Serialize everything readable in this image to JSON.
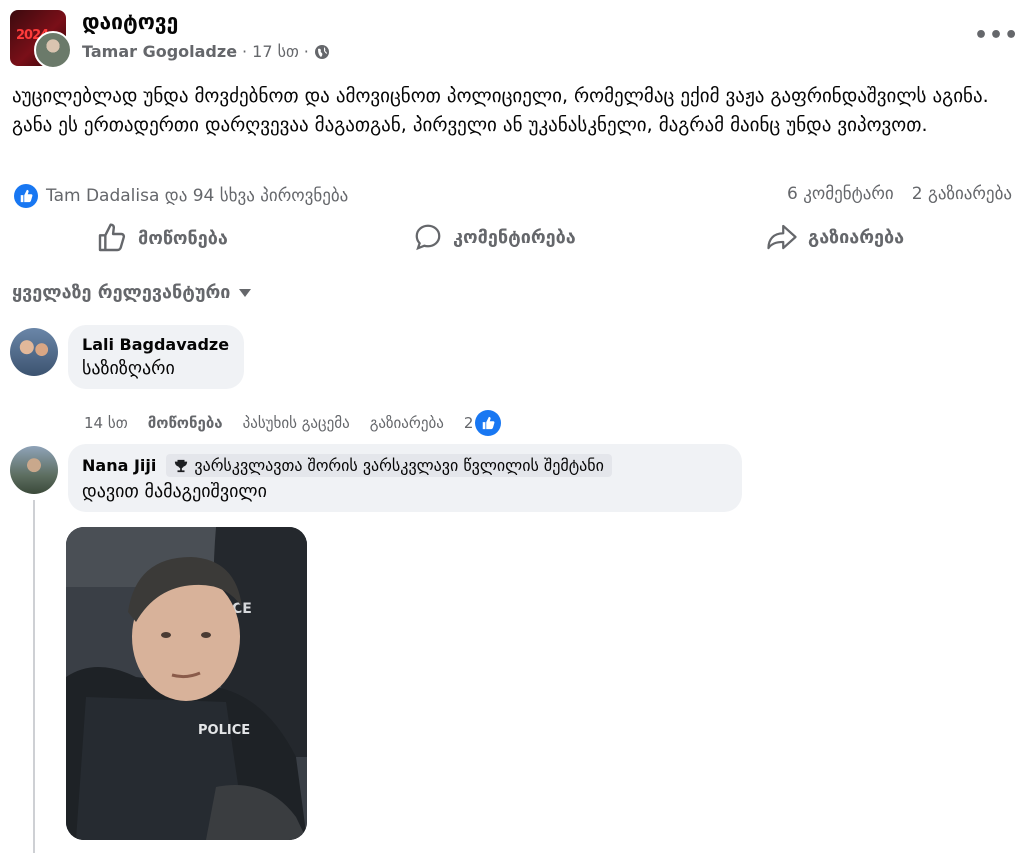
{
  "post": {
    "group_name": "დაიტოვე",
    "author": "Tamar Gogoladze",
    "time": "17 სთ",
    "dot": "·",
    "privacy_icon": "globe-icon",
    "more_label": "•••",
    "text": "აუცილებლად უნდა მოვძებნოთ და ამოვიცნოთ პოლიციელი, რომელმაც ექიმ ვაჟა გაფრინდაშვილს აგინა. განა ეს ერთადერთი დარღვევაა მაგათგან, პირველი ან უკანასკნელი, მაგრამ მაინც უნდა ვიპოვოთ.",
    "reactions_text": "Tam Dadalisa და 94 სხვა პიროვნება",
    "comments_count": "6 კომენტარი",
    "shares_count": "2 გაზიარება"
  },
  "actions": {
    "like": "მოწონება",
    "comment": "კომენტირება",
    "share": "გაზიარება"
  },
  "sort_label": "ყველაზე რელევანტური",
  "comments": [
    {
      "author": "Lali Bagdavadze",
      "text": "საზიზღარი",
      "time": "14 სთ",
      "like": "მოწონება",
      "reply": "პასუხის გაცემა",
      "share": "გაზიარება",
      "reactions": "2"
    },
    {
      "author": "Nana Jiji",
      "badge": "ვარსკვლავთა შორის ვარსკვლავი წვლილის შემტანი",
      "text": "დავით მამაგეიშვილი"
    }
  ],
  "colors": {
    "accent": "#1877f2",
    "secondary_text": "#65676b",
    "bubble": "#f0f2f5"
  }
}
